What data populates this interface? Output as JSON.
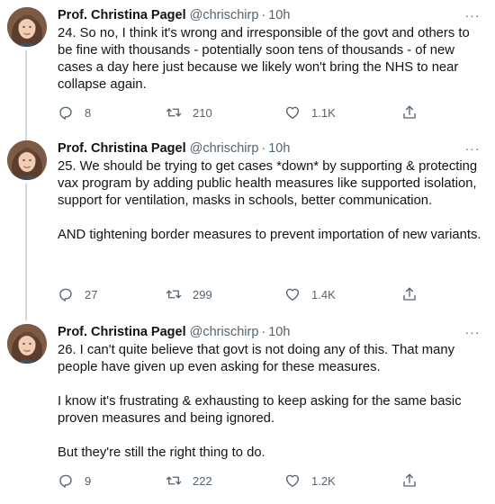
{
  "author": {
    "name": "Prof. Christina Pagel",
    "handle": "@chrischirp"
  },
  "separator": "·",
  "more_glyph": "···",
  "tweets": [
    {
      "time": "10h",
      "text": "24. So no, I think it's wrong and irresponsible of the govt and others to be fine with thousands - potentially soon tens of thousands - of new cases a day here just because we likely won't bring the NHS to near collapse again.",
      "replies": "8",
      "retweets": "210",
      "likes": "1.1K"
    },
    {
      "time": "10h",
      "text": "25. We should be trying to get cases *down* by supporting & protecting vax program by adding public health measures like supported isolation, support for ventilation, masks in schools, better communication.\n\nAND tightening border measures to prevent importation of new variants.",
      "replies": "27",
      "retweets": "299",
      "likes": "1.4K"
    },
    {
      "time": "10h",
      "text": "26. I can't quite believe that govt is not doing any of this. That many people have given up even asking for these measures.\n\nI know it's frustrating & exhausting to keep asking for the same basic proven measures and being ignored.\n\nBut they're still the right thing to do.",
      "replies": "9",
      "retweets": "222",
      "likes": "1.2K"
    }
  ],
  "icons": {
    "avatar": "profile-photo",
    "reply": "reply-icon",
    "retweet": "retweet-icon",
    "like": "like-icon",
    "share": "share-icon",
    "more": "more-icon"
  },
  "colors": {
    "text": "#0f1419",
    "secondary": "#536471",
    "thread_line": "#cfd9de",
    "background": "#ffffff"
  }
}
